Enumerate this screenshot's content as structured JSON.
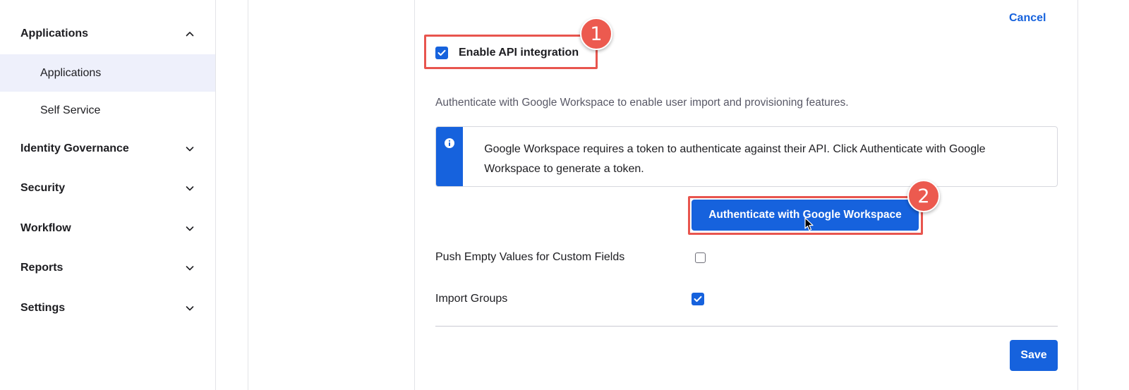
{
  "sidebar": {
    "sections": [
      {
        "label": "Applications",
        "expanded": true,
        "icon": "chevron-up-icon"
      },
      {
        "label": "Identity Governance",
        "expanded": false,
        "icon": "chevron-down-icon"
      },
      {
        "label": "Security",
        "expanded": false,
        "icon": "chevron-down-icon"
      },
      {
        "label": "Workflow",
        "expanded": false,
        "icon": "chevron-down-icon"
      },
      {
        "label": "Reports",
        "expanded": false,
        "icon": "chevron-down-icon"
      },
      {
        "label": "Settings",
        "expanded": false,
        "icon": "chevron-down-icon"
      }
    ],
    "sub_items": [
      {
        "label": "Applications",
        "active": true
      },
      {
        "label": "Self Service",
        "active": false
      }
    ]
  },
  "panel": {
    "cancel_label": "Cancel",
    "enable_api": {
      "label": "Enable API integration",
      "checked": true
    },
    "description": "Authenticate with Google Workspace to enable user import and provisioning features.",
    "callout": {
      "icon": "info-icon",
      "text": "Google Workspace requires a token to authenticate against their API. Click Authenticate with Google Workspace to generate a token."
    },
    "authenticate_label": "Authenticate with Google Workspace",
    "fields": [
      {
        "label": "Push Empty Values for Custom Fields",
        "checked": false
      },
      {
        "label": "Import Groups",
        "checked": true
      }
    ],
    "save_label": "Save"
  },
  "annotations": {
    "step1": "1",
    "step2": "2",
    "highlight_color": "#e8554e"
  },
  "colors": {
    "accent": "#1662dd",
    "active_bg": "#eef0fb"
  }
}
